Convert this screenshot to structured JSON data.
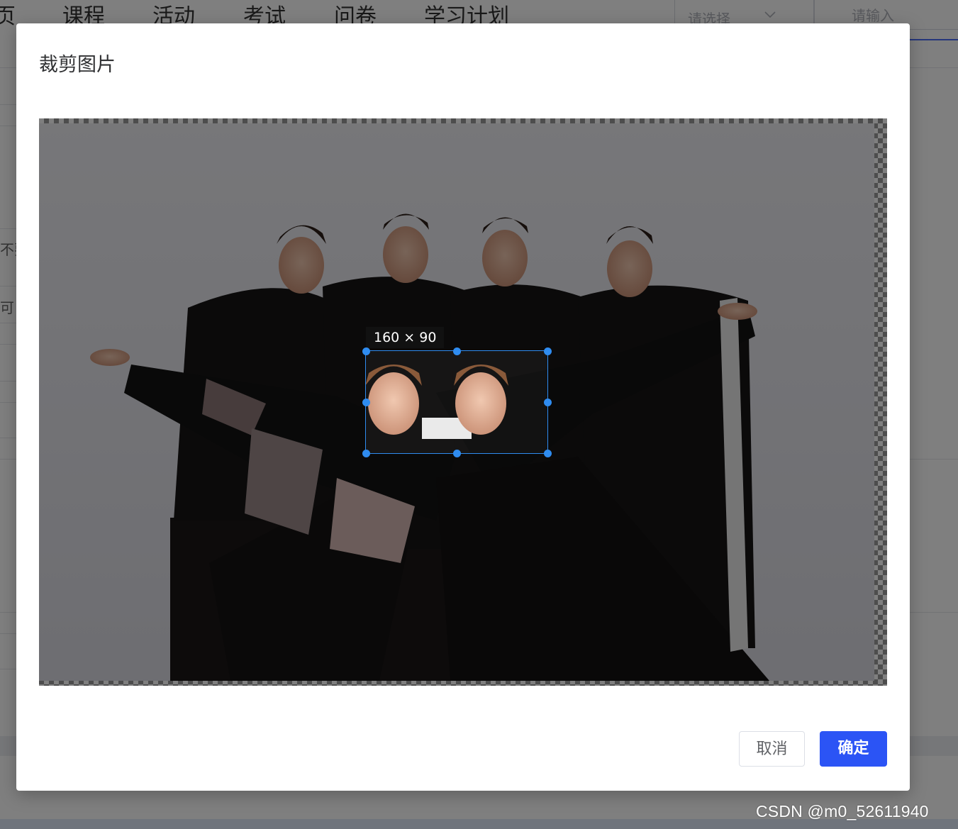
{
  "nav": {
    "items": [
      "页",
      "课程",
      "活动",
      "考试",
      "问卷",
      "学习计划"
    ]
  },
  "search": {
    "select_placeholder": "请选择",
    "input_placeholder": "请输入"
  },
  "background": {
    "side_texts": [
      "不要",
      "可"
    ]
  },
  "dialog": {
    "title": "裁剪图片",
    "crop_size_label": "160 × 90",
    "cancel_label": "取消",
    "confirm_label": "确定"
  },
  "watermark": "CSDN @m0_52611940",
  "colors": {
    "primary": "#2b54f5",
    "crop_handle": "#2f8cf0",
    "mask": "rgba(0,0,0,0.5)"
  }
}
